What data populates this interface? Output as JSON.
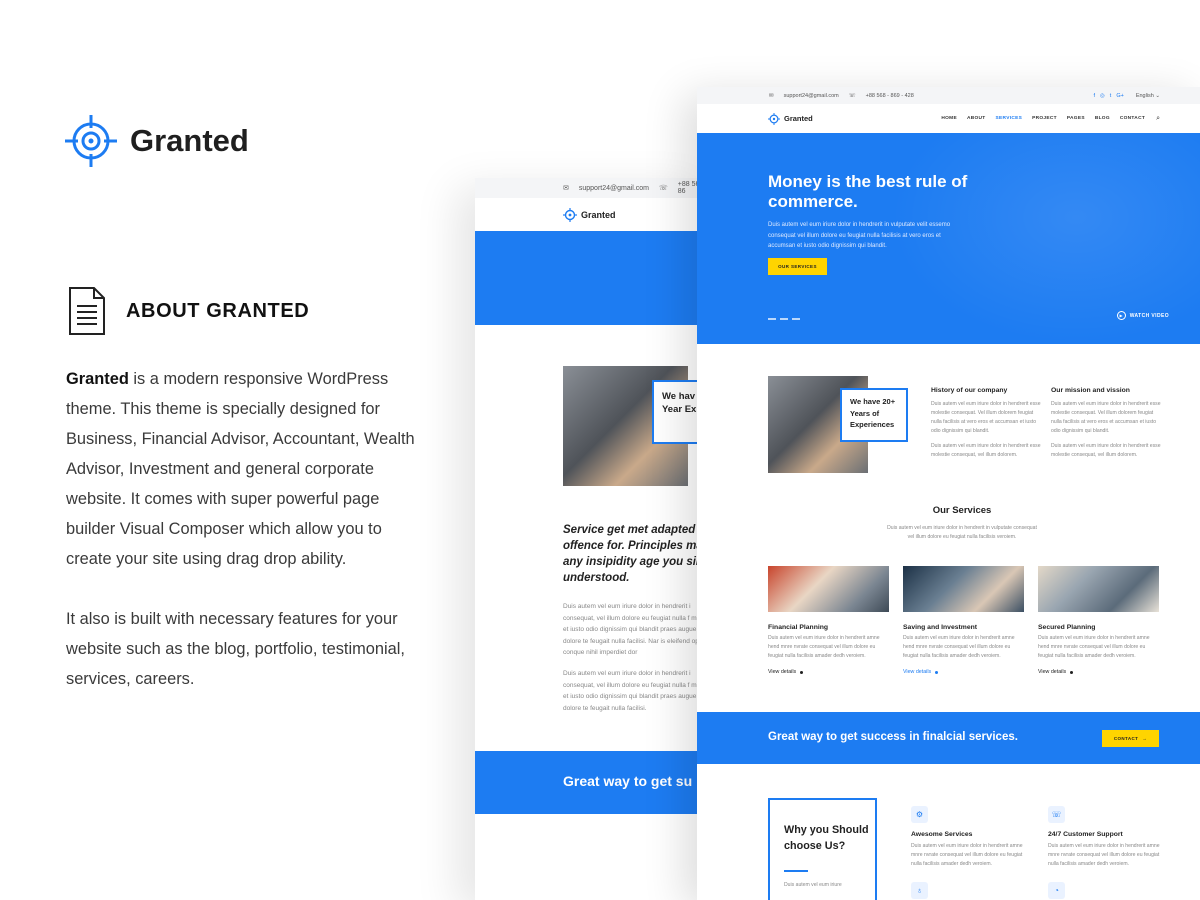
{
  "brand": {
    "name": "Granted"
  },
  "about": {
    "title": "ABOUT GRANTED",
    "para1_strong": "Granted",
    "para1_rest": " is a modern responsive WordPress theme. This theme is specially designed for Business, Financial Advisor, Accountant, Wealth Advisor, Investment and general corporate website. It comes with super powerful page builder Visual Composer which allow you to create your site using drag drop ability.",
    "para2": "It also is built with necessary features for your website such as the blog, portfolio, testimonial, services, careers."
  },
  "back_mockup": {
    "email": "support24@gmail.com",
    "phone": "+88 568 - 86",
    "logo": "Granted",
    "badge": "We hav 20+ Year Experien",
    "italic": "Service get met adapted i offence for. Principles ma any insipidity age you sim understood.",
    "para1": "Duis autem vel eum iriure dolor in hendrerit i consequat, vel illum dolore eu feugiat nulla f msan et iusto odio dignissim qui blandit praes augue duis dolore te feugait nulla facilisi. Nar is eleifend option conque nihil imperdiet dor",
    "para2": "Duis autem vel eum iriure dolor in hendrerit i consequat, vel illum dolore eu feugiat nulla f msan et iusto odio dignissim qui blandit praes augue duis dolore te feugait nulla facilisi.",
    "cta": "Great way to get su"
  },
  "front_mockup": {
    "topbar": {
      "email": "support24@gmail.com",
      "phone": "+88 568 - 869 - 428",
      "social": [
        "f",
        "◎",
        "t",
        "G+"
      ],
      "language": "English ⌄"
    },
    "nav": {
      "logo": "Granted",
      "items": [
        "HOME",
        "ABOUT",
        "SERVICES",
        "PROJECT",
        "PAGES",
        "BLOG",
        "CONTACT"
      ],
      "active_index": 2
    },
    "hero": {
      "title": "Money is the best rule of commerce.",
      "subtitle": "Duis autem vel eum iriure dolor in hendrerit in vulputate velit essemo consequat vel illum dolore eu feugiat nulla facilisis at vero eros et accumsan et iusto odio dignissim qui blandit.",
      "button": "OUR SERVICES",
      "watch_video": "WATCH VIDEO"
    },
    "about": {
      "badge": "We have 20+ Years of Experiences",
      "history_title": "History of our company",
      "history_p1": "Duis autem vel eum iriure dolor in hendrerit esse molestie consequat. Vel illum dolorem feugiat nulla facilisis at vero eros et accumsan et iusto odio dignissim qui blandit.",
      "history_p2": "Duis autem vel eum iriure dolor in hendrerit esse molestie consequat, vel illum dolorem.",
      "mission_title": "Our mission and vission",
      "mission_p1": "Duis autem vel eum iriure dolor in hendrerit esse molestie consequat. Vel illum dolorem feugiat nulla facilisis at vero eros et accumsan et iusto odio dignissim qui blandit.",
      "mission_p2": "Duis autem vel eum iriure dolor in hendrerit esse molestie consequat, vel illum dolorem."
    },
    "services": {
      "title": "Our Services",
      "subtitle": "Duis autem vel eum iriure dolor in hendrerit in vulputate consequat vel illum dolore eu feugiat nulla facilisis veroiem.",
      "cards": [
        {
          "title": "Financial Planning",
          "text": "Duis autem vel eum iriure dolor in hendrerit amne hend mnre nvrate consequat vel illum dolore eu feugiat nulla facilisis amader dedh veroiem.",
          "link": "View details"
        },
        {
          "title": "Saving and Investment",
          "text": "Duis autem vel eum iriure dolor in hendrerit amne hend mnre nvrate consequat vel illum dolore eu feugiat nulla facilisis amader dedh veroiem.",
          "link": "View details"
        },
        {
          "title": "Secured Planning",
          "text": "Duis autem vel eum iriure dolor in hendrerit amne hend mnre nvrate consequat vel illum dolore eu feugiat nulla facilisis amader dedh veroiem.",
          "link": "View details"
        }
      ]
    },
    "cta": {
      "text": "Great way to get success in finalcial services.",
      "button": "CONTACT"
    },
    "why": {
      "title": "Why you Should choose Us?",
      "text": "Duis autem vel eum iriure",
      "features": [
        {
          "title": "Awesome Services",
          "text": "Duis autem vel eum iriure dolor in hendrerit amne mnre nvrate consequat vel illum dolore eu feugiat nulla facilisis amader dedh veroiem."
        },
        {
          "title": "24/7 Customer Support",
          "text": "Duis autem vel eum iriure dolor in hendrerit amne mnre nvrate consequat vel illum dolore eu feugiat nulla facilisis amader dedh veroiem."
        }
      ]
    }
  },
  "colors": {
    "accent": "#1d7cf2",
    "button_yellow": "#ffd400"
  }
}
